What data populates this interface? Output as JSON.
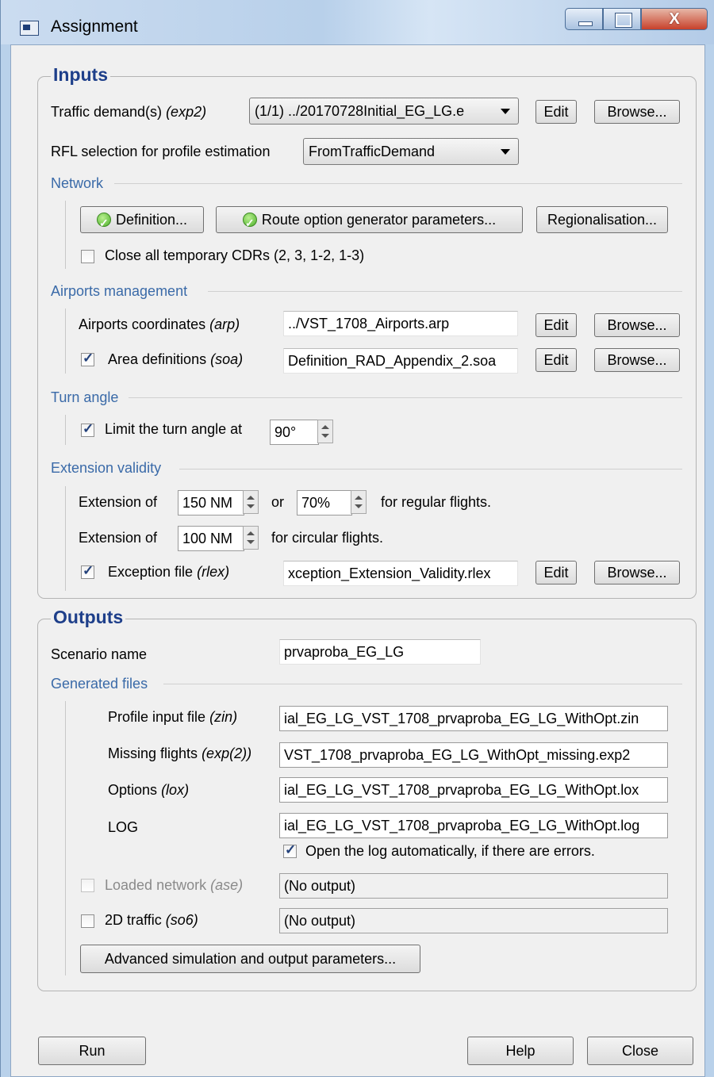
{
  "window": {
    "title": "Assignment",
    "buttons": {
      "minimize": "minimize",
      "maximize": "maximize",
      "close": "X"
    }
  },
  "inputs": {
    "title": "Inputs",
    "traffic_demand": {
      "label": "Traffic demand(s)",
      "ext": "(exp2)",
      "value": "(1/1) ../20170728Initial_EG_LG.e",
      "edit": "Edit",
      "browse": "Browse..."
    },
    "rfl": {
      "label": "RFL selection for profile estimation",
      "value": "FromTrafficDemand"
    },
    "network": {
      "title": "Network",
      "definition_button": "Definition...",
      "route_button": "Route option generator parameters...",
      "regionalisation_button": "Regionalisation...",
      "close_cdrs": {
        "label": "Close all temporary CDRs (2, 3, 1-2, 1-3)",
        "checked": false
      }
    },
    "airports": {
      "title": "Airports management",
      "coords": {
        "label": "Airports coordinates",
        "ext": "(arp)",
        "value": "../VST_1708_Airports.arp",
        "edit": "Edit",
        "browse": "Browse..."
      },
      "area": {
        "label": "Area definitions",
        "ext": "(soa)",
        "value": "Definition_RAD_Appendix_2.soa",
        "checked": true,
        "edit": "Edit",
        "browse": "Browse..."
      }
    },
    "turn_angle": {
      "title": "Turn angle",
      "label": "Limit the turn angle at",
      "value": "90°",
      "checked": true
    },
    "extension": {
      "title": "Extension validity",
      "regular_prefix": "Extension of",
      "regular_nm": "150 NM",
      "or": "or",
      "regular_pct": "70%",
      "regular_suffix": "for regular flights.",
      "circular_prefix": "Extension of",
      "circular_nm": "100 NM",
      "circular_suffix": "for circular flights.",
      "exception": {
        "label": "Exception file",
        "ext": "(rlex)",
        "value": "xception_Extension_Validity.rlex",
        "checked": true,
        "edit": "Edit",
        "browse": "Browse..."
      }
    }
  },
  "outputs": {
    "title": "Outputs",
    "scenario": {
      "label": "Scenario name",
      "value": "prvaproba_EG_LG"
    },
    "generated": {
      "title": "Generated files",
      "profile": {
        "label": "Profile input file",
        "ext": "(zin)",
        "value": "ial_EG_LG_VST_1708_prvaproba_EG_LG_WithOpt.zin"
      },
      "missing": {
        "label": "Missing flights",
        "ext": "(exp(2))",
        "value": "VST_1708_prvaproba_EG_LG_WithOpt_missing.exp2"
      },
      "options": {
        "label": "Options",
        "ext": "(lox)",
        "value": "ial_EG_LG_VST_1708_prvaproba_EG_LG_WithOpt.lox"
      },
      "log": {
        "label": "LOG",
        "value": "ial_EG_LG_VST_1708_prvaproba_EG_LG_WithOpt.log"
      },
      "open_log": {
        "label": "Open the log automatically, if there are errors.",
        "checked": true
      },
      "loaded_network": {
        "label": "Loaded network",
        "ext": "(ase)",
        "value": "(No output)",
        "checked": false
      },
      "traffic_2d": {
        "label": "2D traffic",
        "ext": "(so6)",
        "value": "(No output)",
        "checked": false
      },
      "advanced_button": "Advanced simulation and output parameters..."
    }
  },
  "footer": {
    "run": "Run",
    "help": "Help",
    "close": "Close"
  }
}
